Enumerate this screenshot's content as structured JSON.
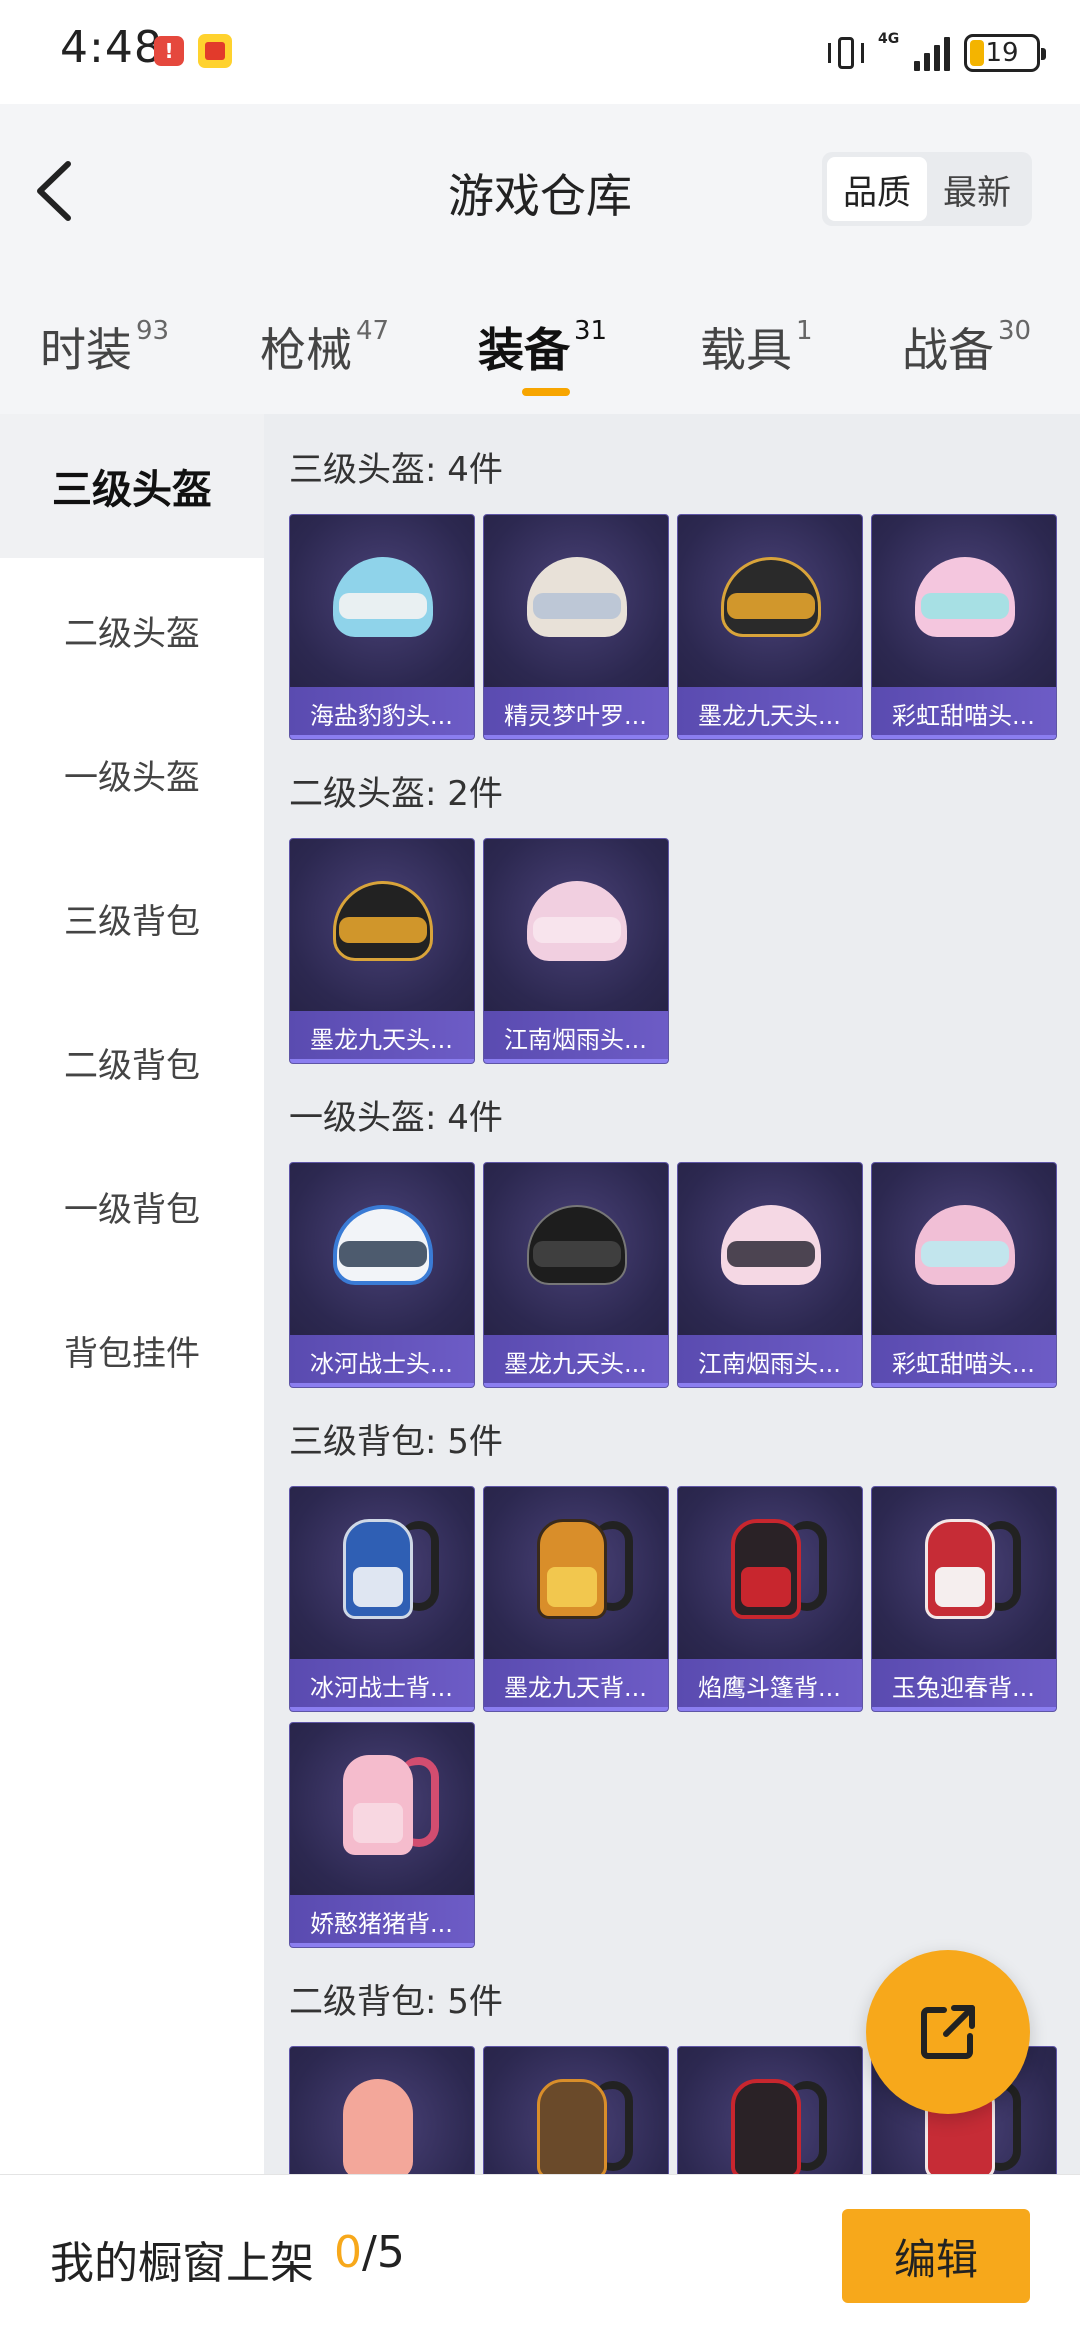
{
  "status_bar": {
    "time": "4:48",
    "app_icon_1": "!",
    "network": "4G",
    "battery": "19"
  },
  "header": {
    "title": "游戏仓库",
    "back_icon": "chevron-left-icon",
    "sort": [
      "品质",
      "最新"
    ],
    "sort_active": "品质"
  },
  "tabs": [
    {
      "label": "时装",
      "count": "93"
    },
    {
      "label": "枪械",
      "count": "47"
    },
    {
      "label": "装备",
      "count": "31",
      "active": true
    },
    {
      "label": "载具",
      "count": "1"
    },
    {
      "label": "战备",
      "count": "30"
    }
  ],
  "sidebar": [
    "三级头盔",
    "二级头盔",
    "一级头盔",
    "三级背包",
    "二级背包",
    "一级背包",
    "背包挂件"
  ],
  "sections": [
    {
      "title": "三级头盔: 4件",
      "items": [
        "海盐豹豹头...",
        "精灵梦叶罗...",
        "墨龙九天头...",
        "彩虹甜喵头..."
      ]
    },
    {
      "title": "二级头盔: 2件",
      "items": [
        "墨龙九天头...",
        "江南烟雨头..."
      ]
    },
    {
      "title": "一级头盔: 4件",
      "items": [
        "冰河战士头...",
        "墨龙九天头...",
        "江南烟雨头...",
        "彩虹甜喵头..."
      ]
    },
    {
      "title": "三级背包: 5件",
      "items": [
        "冰河战士背...",
        "墨龙九天背...",
        "焰鹰斗篷背...",
        "玉兔迎春背...",
        "娇憨猪猪背..."
      ]
    },
    {
      "title": "二级背包: 5件",
      "items": [
        "",
        "",
        "",
        ""
      ]
    }
  ],
  "share_icon": "share-external-icon",
  "bottom": {
    "showcase_label": "我的橱窗上架",
    "showcase_current": "0",
    "showcase_total": "/5",
    "edit_label": "编辑"
  },
  "colors": {
    "accent": "#f7a81b",
    "card_label": "#5a4bb0",
    "card_bg": "#2c2850"
  }
}
